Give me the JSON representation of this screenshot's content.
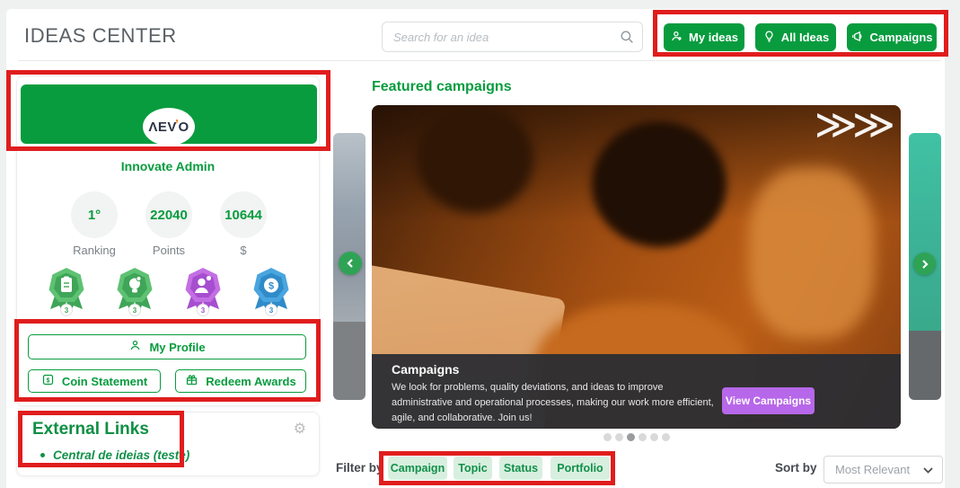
{
  "colors": {
    "primary_green": "#089c3e",
    "annotation_red": "#e01d1d",
    "cta_purple": "#b767e9",
    "pill_bg": "#d8efdf",
    "pill_text": "#12904b"
  },
  "header": {
    "title": "IDEAS CENTER",
    "search_placeholder": "Search for an idea",
    "buttons": [
      {
        "label": "My ideas",
        "icon": "person-icon"
      },
      {
        "label": "All Ideas",
        "icon": "lightbulb-icon"
      },
      {
        "label": "Campaigns",
        "icon": "megaphone-icon"
      }
    ]
  },
  "profile": {
    "logo": {
      "part1": "ΛEV",
      "accent": "’",
      "part2": "O"
    },
    "name": "Innovate Admin",
    "stats": [
      {
        "value": "1°",
        "label": "Ranking"
      },
      {
        "value": "22040",
        "label": "Points"
      },
      {
        "value": "10644",
        "label": "$"
      }
    ],
    "badges": [
      {
        "name": "notes-badge",
        "count": "3",
        "color": "#5ec272",
        "color_dark": "#3fa558"
      },
      {
        "name": "idea-badge",
        "count": "3",
        "color": "#5ec272",
        "color_dark": "#3fa558"
      },
      {
        "name": "profile-badge",
        "count": "3",
        "color": "#c36fe3",
        "color_dark": "#a64ecf"
      },
      {
        "name": "money-badge",
        "count": "3",
        "color": "#4aa5df",
        "color_dark": "#2f8bc9"
      }
    ],
    "buttons": {
      "my_profile": "My Profile",
      "coin_statement": "Coin Statement",
      "redeem_awards": "Redeem Awards"
    }
  },
  "external_links": {
    "title": "External Links",
    "items": [
      {
        "label": "Central de ideias (teste)"
      }
    ]
  },
  "featured": {
    "heading": "Featured campaigns",
    "slide": {
      "decor": "≫≫",
      "title": "Campaigns",
      "description": "We look for problems, quality deviations, and ideas to improve administrative and operational processes, making our work more efficient, agile, and collaborative. Join us!",
      "cta": "View Campaigns"
    },
    "dots_total": 6,
    "active_dot": 3
  },
  "filter": {
    "label": "Filter by",
    "pills": [
      {
        "label": "Campaign"
      },
      {
        "label": "Topic"
      },
      {
        "label": "Status"
      },
      {
        "label": "Portfolio"
      }
    ]
  },
  "sort": {
    "label": "Sort by",
    "selected": "Most Relevant"
  }
}
